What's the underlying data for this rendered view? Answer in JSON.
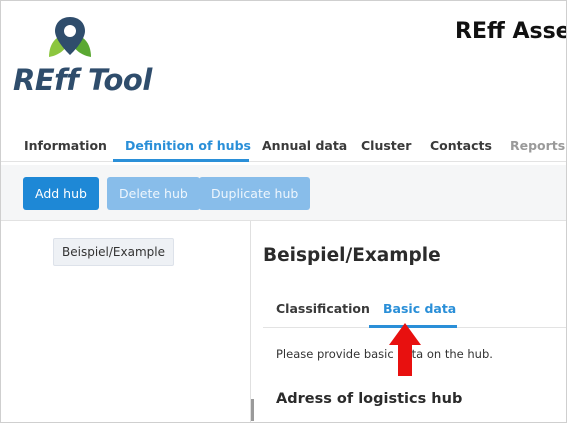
{
  "header": {
    "logo_text": "REff Tool",
    "app_title": "REff Asse"
  },
  "topnav": {
    "tabs": [
      {
        "label": "Information",
        "state": "normal"
      },
      {
        "label": "Definition of hubs",
        "state": "active"
      },
      {
        "label": "Annual data",
        "state": "normal"
      },
      {
        "label": "Cluster",
        "state": "normal"
      },
      {
        "label": "Contacts",
        "state": "normal"
      },
      {
        "label": "Reports",
        "state": "muted"
      }
    ]
  },
  "toolbar": {
    "add_label": "Add hub",
    "delete_label": "Delete hub",
    "duplicate_label": "Duplicate hub"
  },
  "sidebar": {
    "items": [
      {
        "label": "Beispiel/Example",
        "selected": true
      }
    ]
  },
  "main": {
    "title": "Beispiel/Example",
    "tabs": [
      {
        "label": "Classification",
        "active": false
      },
      {
        "label": "Basic data",
        "active": true
      }
    ],
    "info_text": "Please provide basic data on the hub.",
    "section_heading": "Adress of logistics hub"
  },
  "colors": {
    "accent": "#2a8fd8",
    "primary_button": "#1e88d6",
    "disabled_button": "#88bdea",
    "annotation_arrow": "#e8100f",
    "logo_text": "#2f4d6c"
  },
  "icons": {
    "logo": "location-pin-leaf-icon",
    "annotation": "arrow-up-icon"
  }
}
